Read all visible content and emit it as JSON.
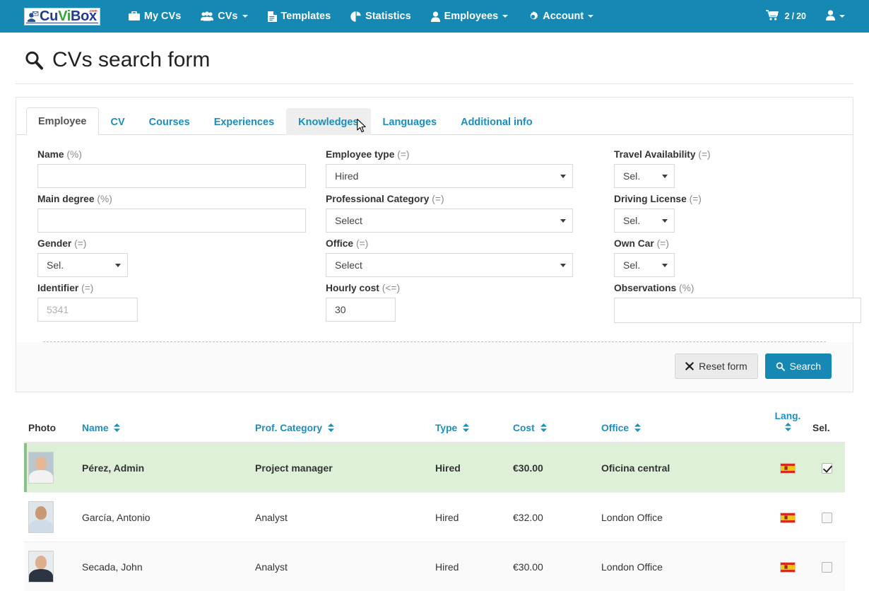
{
  "navbar": {
    "brand": {
      "part1": "Cu",
      "part2": "Vi",
      "part3": "Box",
      "tld": ".com",
      "icon": "cuvibox-logo-icon"
    },
    "items": [
      {
        "label": "My CVs",
        "icon": "briefcase-icon",
        "caret": false
      },
      {
        "label": "CVs",
        "icon": "users-group-icon",
        "caret": true
      },
      {
        "label": "Templates",
        "icon": "file-text-icon",
        "caret": false
      },
      {
        "label": "Statistics",
        "icon": "pie-chart-icon",
        "caret": false
      },
      {
        "label": "Employees",
        "icon": "user-icon",
        "caret": true
      },
      {
        "label": "Account",
        "icon": "gear-icon",
        "caret": true
      }
    ],
    "cart": {
      "icon": "shopping-cart-icon",
      "count": "2",
      "separator": "/",
      "total": "20"
    },
    "user_menu": {
      "icon": "user-icon",
      "caret": true
    }
  },
  "page": {
    "title": "CVs search form",
    "title_icon": "search-icon"
  },
  "tabs": [
    {
      "label": "Employee",
      "state": "active"
    },
    {
      "label": "CV",
      "state": "normal"
    },
    {
      "label": "Courses",
      "state": "normal"
    },
    {
      "label": "Experiences",
      "state": "normal"
    },
    {
      "label": "Knowledges",
      "state": "hover"
    },
    {
      "label": "Languages",
      "state": "normal"
    },
    {
      "label": "Additional info",
      "state": "normal"
    }
  ],
  "form": {
    "col1": [
      {
        "label": "Name",
        "op": "(%)",
        "type": "text",
        "value": "",
        "placeholder": ""
      },
      {
        "label": "Main degree",
        "op": "(%)",
        "type": "text",
        "value": "",
        "placeholder": ""
      },
      {
        "label": "Gender",
        "op": "(=)",
        "type": "select",
        "value": "Sel."
      },
      {
        "label": "Identifier",
        "op": "(=)",
        "type": "text",
        "value": "",
        "placeholder": "5341"
      }
    ],
    "col2": [
      {
        "label": "Employee type",
        "op": "(=)",
        "type": "select",
        "value": "Hired"
      },
      {
        "label": "Professional Category",
        "op": "(=)",
        "type": "select",
        "value": "Select"
      },
      {
        "label": "Office",
        "op": "(=)",
        "type": "select",
        "value": "Select"
      },
      {
        "label": "Hourly cost",
        "op": "(<=)",
        "type": "text",
        "value": "30",
        "placeholder": ""
      }
    ],
    "col3": [
      {
        "label": "Travel Availability",
        "op": "(=)",
        "type": "select",
        "value": "Sel."
      },
      {
        "label": "Driving License",
        "op": "(=)",
        "type": "select",
        "value": "Sel."
      },
      {
        "label": "Own Car",
        "op": "(=)",
        "type": "select",
        "value": "Sel."
      },
      {
        "label": "Observations",
        "op": "(%)",
        "type": "text",
        "value": "",
        "placeholder": ""
      }
    ],
    "buttons": {
      "reset": {
        "label": "Reset form",
        "icon": "close-x-icon"
      },
      "search": {
        "label": "Search",
        "icon": "search-icon"
      }
    }
  },
  "results": {
    "columns": [
      {
        "label": "Photo",
        "sortable": false
      },
      {
        "label": "Name",
        "sortable": true
      },
      {
        "label": "Prof. Category",
        "sortable": true
      },
      {
        "label": "Type",
        "sortable": true
      },
      {
        "label": "Cost",
        "sortable": true
      },
      {
        "label": "Office",
        "sortable": true
      },
      {
        "label": "Lang.",
        "sortable": true
      },
      {
        "label": "Sel.",
        "sortable": false
      }
    ],
    "rows": [
      {
        "name": "Pérez, Admin",
        "category": "Project manager",
        "type": "Hired",
        "cost": "€30.00",
        "office": "Oficina central",
        "lang": "spain-flag-icon",
        "selected": true,
        "highlight": true,
        "avatar": "avatar-perez-admin"
      },
      {
        "name": "García, Antonio",
        "category": "Analyst",
        "type": "Hired",
        "cost": "€32.00",
        "office": "London Office",
        "lang": "spain-flag-icon",
        "selected": false,
        "highlight": false,
        "avatar": "avatar-garcia-antonio"
      },
      {
        "name": "Secada, John",
        "category": "Analyst",
        "type": "Hired",
        "cost": "€30.00",
        "office": "London Office",
        "lang": "spain-flag-icon",
        "selected": false,
        "highlight": false,
        "avatar": "avatar-secada-john"
      }
    ]
  },
  "colors": {
    "brand_blue": "#1588b4",
    "link_blue": "#1a8fbd",
    "row_highlight_green": "#dff0d8",
    "row_highlight_border": "#86c286"
  }
}
